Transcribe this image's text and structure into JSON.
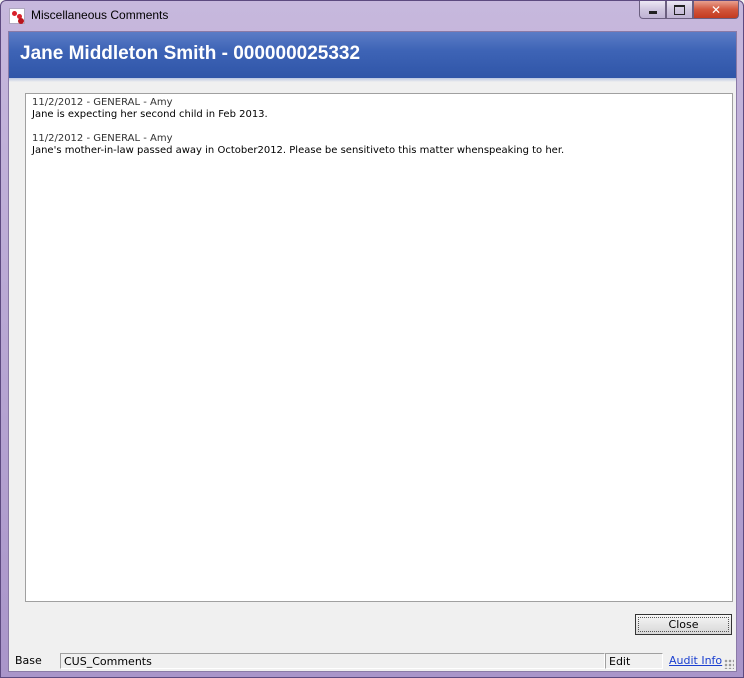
{
  "window": {
    "title": "Miscellaneous Comments",
    "icon": "app-logo-icon",
    "controls": {
      "minimize": "minimize-icon",
      "maximize": "maximize-icon",
      "close": "close-icon"
    }
  },
  "header": {
    "title": "Jane Middleton Smith - 000000025332"
  },
  "comments": [
    {
      "heading": "11/2/2012 - GENERAL - Amy",
      "text": "Jane is expecting her second child in Feb 2013."
    },
    {
      "heading": "11/2/2012 - GENERAL - Amy",
      "text": "Jane's mother-in-law passed away in October2012. Please be sensitiveto this matter whenspeaking to her."
    }
  ],
  "buttons": {
    "close_label": "Close"
  },
  "statusbar": {
    "base": "Base",
    "form": "CUS_Comments",
    "mode": "Edit",
    "audit_link": "Audit Info"
  },
  "colors": {
    "header_band": "#3e64b6",
    "link": "#1a3fd0",
    "window_frame": "#a995c9"
  }
}
